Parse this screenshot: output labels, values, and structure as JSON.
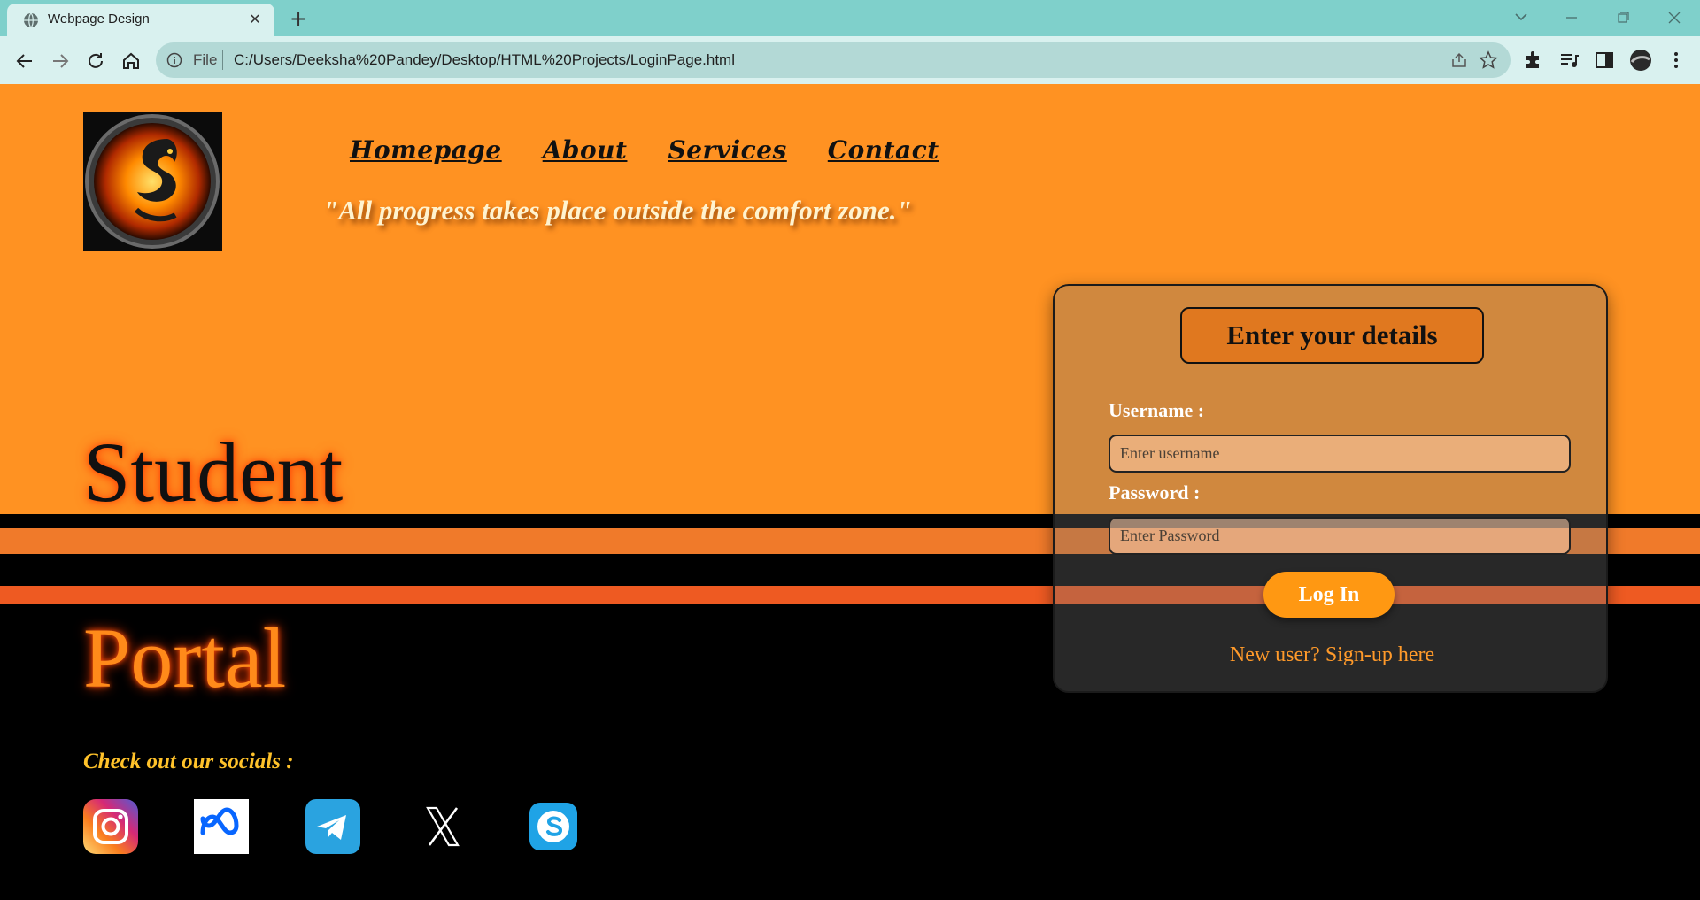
{
  "browser": {
    "tab_title": "Webpage Design",
    "tab_close": "✕",
    "new_tab": "+",
    "scheme_label": "File",
    "url": "C:/Users/Deeksha%20Pandey/Desktop/HTML%20Projects/LoginPage.html",
    "icons": [
      "globe-icon",
      "back-icon",
      "forward-icon",
      "reload-icon",
      "home-icon",
      "info-icon",
      "share-icon",
      "star-icon",
      "extensions-icon",
      "media-queue-icon",
      "side-panel-icon",
      "profile-avatar",
      "menu-icon"
    ]
  },
  "header": {
    "nav": [
      "Homepage",
      "About",
      "Services",
      "Contact"
    ],
    "quote": "\"All progress takes place outside the comfort zone.\""
  },
  "hero": {
    "line1": "Student",
    "line2": "Portal"
  },
  "login": {
    "heading": "Enter your details",
    "username_label": "Username :",
    "username_placeholder": "Enter username",
    "password_label": "Password :",
    "password_placeholder": "Enter Password",
    "submit_label": "Log In",
    "signup_text": "New user? Sign-up here"
  },
  "socials": {
    "heading": "Check out our socials :",
    "items": [
      "instagram-icon",
      "meta-icon",
      "telegram-icon",
      "x-icon",
      "skype-icon"
    ]
  },
  "colors": {
    "page_orange": "#ff9222",
    "stripe_orange": "#f07a2a",
    "stripe_red_orange": "#ee5a22",
    "nav_text": "#111111",
    "quote_text": "#fff3cf",
    "portal_text": "#ff8a1a",
    "card_heading_bg": "#e0781f",
    "login_button": "#ff9812",
    "socials_heading": "#ffc22a",
    "chrome_teal": "#7fd0cb"
  }
}
